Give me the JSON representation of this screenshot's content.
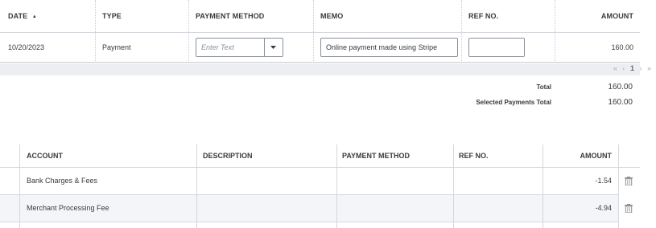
{
  "payments_table": {
    "headers": {
      "date": "DATE",
      "type": "TYPE",
      "payment_method": "PAYMENT METHOD",
      "memo": "MEMO",
      "ref_no": "REF NO.",
      "amount": "AMOUNT"
    },
    "sort_indicator": "▲",
    "row": {
      "date": "10/20/2023",
      "type": "Payment",
      "payment_method_placeholder": "Enter Text",
      "payment_method_value": "",
      "memo": "Online payment made using Stripe",
      "ref_no": "",
      "amount": "160.00"
    }
  },
  "pagination": {
    "first": "«",
    "prev": "‹",
    "current": "1",
    "next": "›",
    "last": "»"
  },
  "totals": {
    "total_label": "Total",
    "total_value": "160.00",
    "selected_label": "Selected Payments Total",
    "selected_value": "160.00"
  },
  "expenses_table": {
    "headers": {
      "account": "ACCOUNT",
      "description": "DESCRIPTION",
      "payment_method": "PAYMENT METHOD",
      "ref_no": "REF NO.",
      "amount": "AMOUNT"
    },
    "rows": [
      {
        "account": "Bank Charges & Fees",
        "description": "",
        "payment_method": "",
        "ref_no": "",
        "amount": "-1.54"
      },
      {
        "account": "Merchant Processing Fee",
        "description": "",
        "payment_method": "",
        "ref_no": "",
        "amount": "-4.94"
      }
    ]
  },
  "icons": {
    "dropdown": "chevron-down-icon",
    "delete": "trash-icon"
  },
  "colors": {
    "text": "#393a3d",
    "border": "#d4d7dc",
    "input_border": "#8d9096",
    "stripe_bg": "#eceef1",
    "row_alt_bg": "#f4f5f8"
  }
}
